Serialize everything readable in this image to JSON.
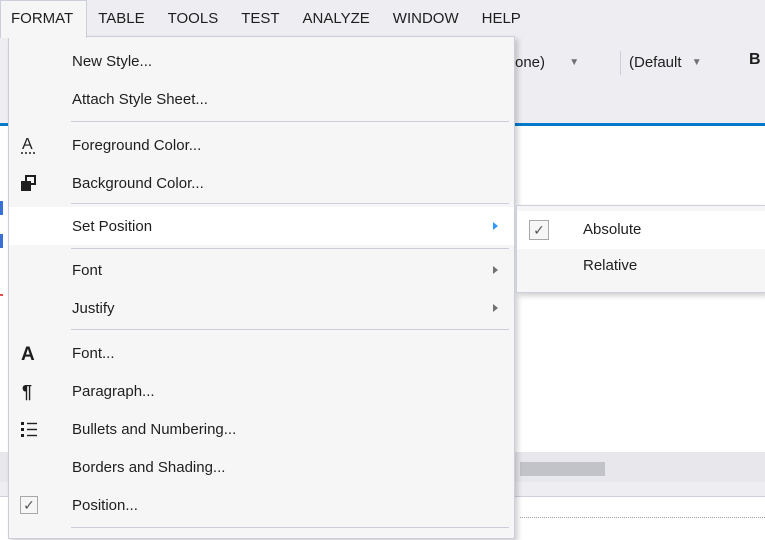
{
  "menubar": {
    "items": [
      {
        "label": "FORMAT"
      },
      {
        "label": "TABLE"
      },
      {
        "label": "TOOLS"
      },
      {
        "label": "TEST"
      },
      {
        "label": "ANALYZE"
      },
      {
        "label": "WINDOW"
      },
      {
        "label": "HELP"
      }
    ]
  },
  "toolbar": {
    "dropdown_1": "one)",
    "dropdown_2": "(Default",
    "bold_glyph": "B"
  },
  "format_menu": {
    "new_style": "New Style...",
    "attach_style_sheet": "Attach Style Sheet...",
    "foreground_color": "Foreground Color...",
    "background_color": "Background Color...",
    "set_position": "Set Position",
    "font_submenu": "Font",
    "justify": "Justify",
    "font_dialog": "Font...",
    "paragraph": "Paragraph...",
    "bullets_numbering": "Bullets and Numbering...",
    "borders_shading": "Borders and Shading...",
    "position": "Position..."
  },
  "set_position_submenu": {
    "absolute": "Absolute",
    "relative": "Relative"
  },
  "icons": {
    "foreground": "foreground-color-icon",
    "background": "background-color-icon",
    "font": "font-icon",
    "paragraph": "paragraph-icon",
    "bullets": "bullets-icon",
    "check": "checkbox-checked-icon"
  },
  "colors": {
    "menu_bg": "#f6f6f6",
    "highlight": "#ffffff",
    "border": "#cccedb",
    "accent": "#007acc",
    "submenu_arrow_active": "#3399ff"
  }
}
